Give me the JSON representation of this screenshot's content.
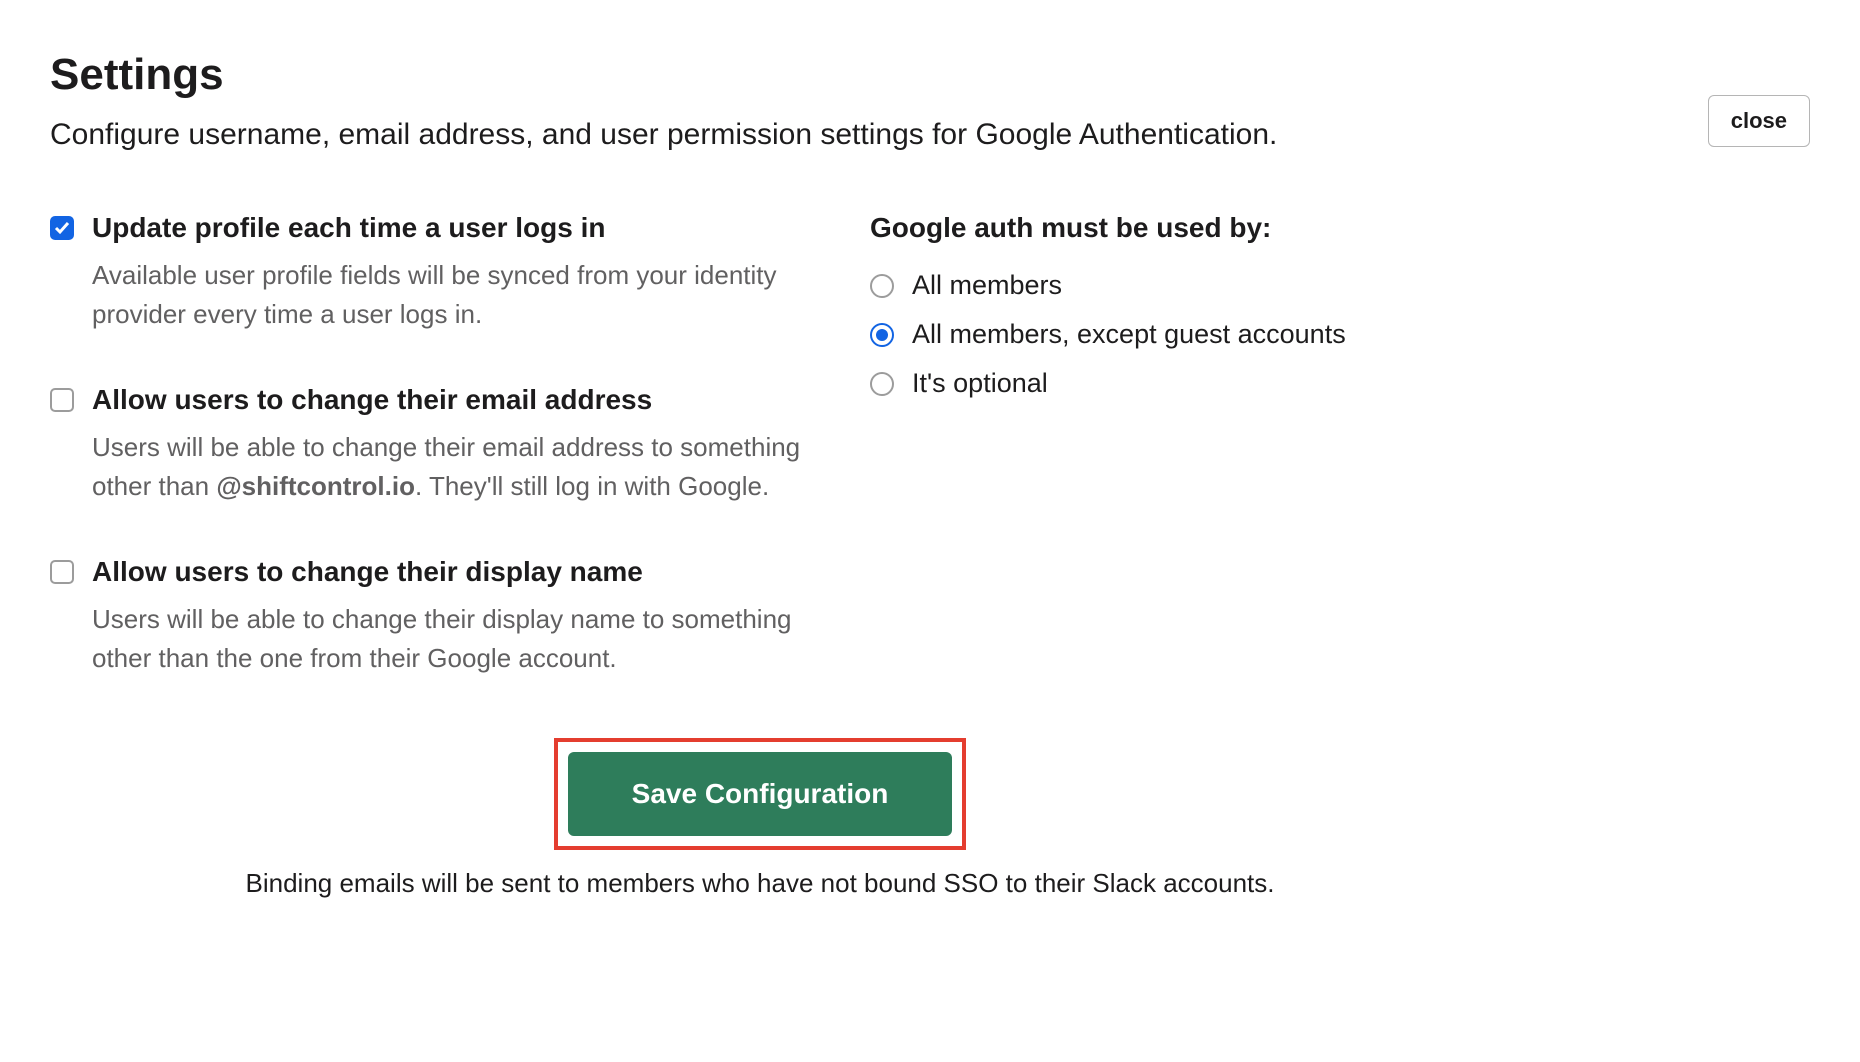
{
  "header": {
    "title": "Settings",
    "subtitle": "Configure username, email address, and user permission settings for Google Authentication.",
    "close_label": "close"
  },
  "checkboxes": {
    "update_profile": {
      "label": "Update profile each time a user logs in",
      "description": "Available user profile fields will be synced from your identity provider every time a user logs in.",
      "checked": true
    },
    "change_email": {
      "label": "Allow users to change their email address",
      "desc_prefix": "Users will be able to change their email address to something other than ",
      "domain": "@shiftcontrol.io",
      "desc_suffix": ". They'll still log in with Google.",
      "checked": false
    },
    "change_display": {
      "label": "Allow users to change their display name",
      "description": "Users will be able to change their display name to something other than the one from their Google account.",
      "checked": false
    }
  },
  "radio": {
    "heading": "Google auth must be used by:",
    "options": {
      "all": {
        "label": "All members",
        "checked": false
      },
      "except_guest": {
        "label": "All members, except guest accounts",
        "checked": true
      },
      "optional": {
        "label": "It's optional",
        "checked": false
      }
    }
  },
  "save_button": "Save Configuration",
  "footer_note": "Binding emails will be sent to members who have not bound SSO to their Slack accounts."
}
